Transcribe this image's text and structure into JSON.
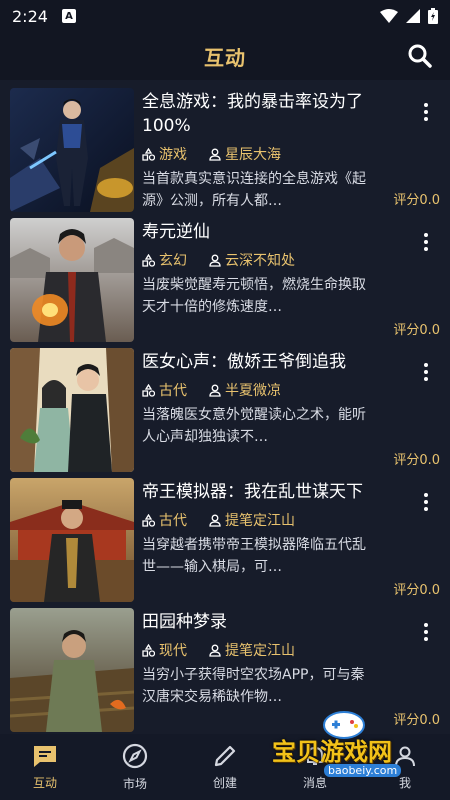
{
  "status_bar": {
    "time": "2:24",
    "notification_letter": "A"
  },
  "header": {
    "title": "互动",
    "search_icon": "search-icon"
  },
  "stories": [
    {
      "title": "全息游戏：我的暴击率设为了100%",
      "genre": "游戏",
      "author": "星辰大海",
      "description": "当首款真实意识连接的全息游戏《起源》公测，所有人都…",
      "rating": "评分0.0"
    },
    {
      "title": "寿元逆仙",
      "genre": "玄幻",
      "author": "云深不知处",
      "description": "当废柴觉醒寿元顿悟，燃烧生命换取天才十倍的修炼速度…",
      "rating": "评分0.0"
    },
    {
      "title": "医女心声：傲娇王爷倒追我",
      "genre": "古代",
      "author": "半夏微凉",
      "description": "当落魄医女意外觉醒读心之术，能听人心声却独独读不…",
      "rating": "评分0.0"
    },
    {
      "title": "帝王模拟器：我在乱世谋天下",
      "genre": "古代",
      "author": "提笔定江山",
      "description": "当穿越者携带帝王模拟器降临五代乱世——输入棋局，可…",
      "rating": "评分0.0"
    },
    {
      "title": "田园种梦录",
      "genre": "现代",
      "author": "提笔定江山",
      "description": "当穷小子获得时空农场APP，可与秦汉唐宋交易稀缺作物…",
      "rating": "评分0.0"
    }
  ],
  "bottom_nav": [
    {
      "label": "互动",
      "icon": "chat-icon",
      "active": true
    },
    {
      "label": "市场",
      "icon": "compass-icon",
      "active": false
    },
    {
      "label": "创建",
      "icon": "pencil-icon",
      "active": false
    },
    {
      "label": "消息",
      "icon": "bell-icon",
      "active": false
    },
    {
      "label": "我",
      "icon": "person-icon",
      "active": false
    }
  ],
  "watermark": {
    "text": "宝贝游戏网",
    "url": "baobeiy.com"
  },
  "colors": {
    "background": "#171c2a",
    "accent": "#e8c26e",
    "text": "#ffffff"
  }
}
